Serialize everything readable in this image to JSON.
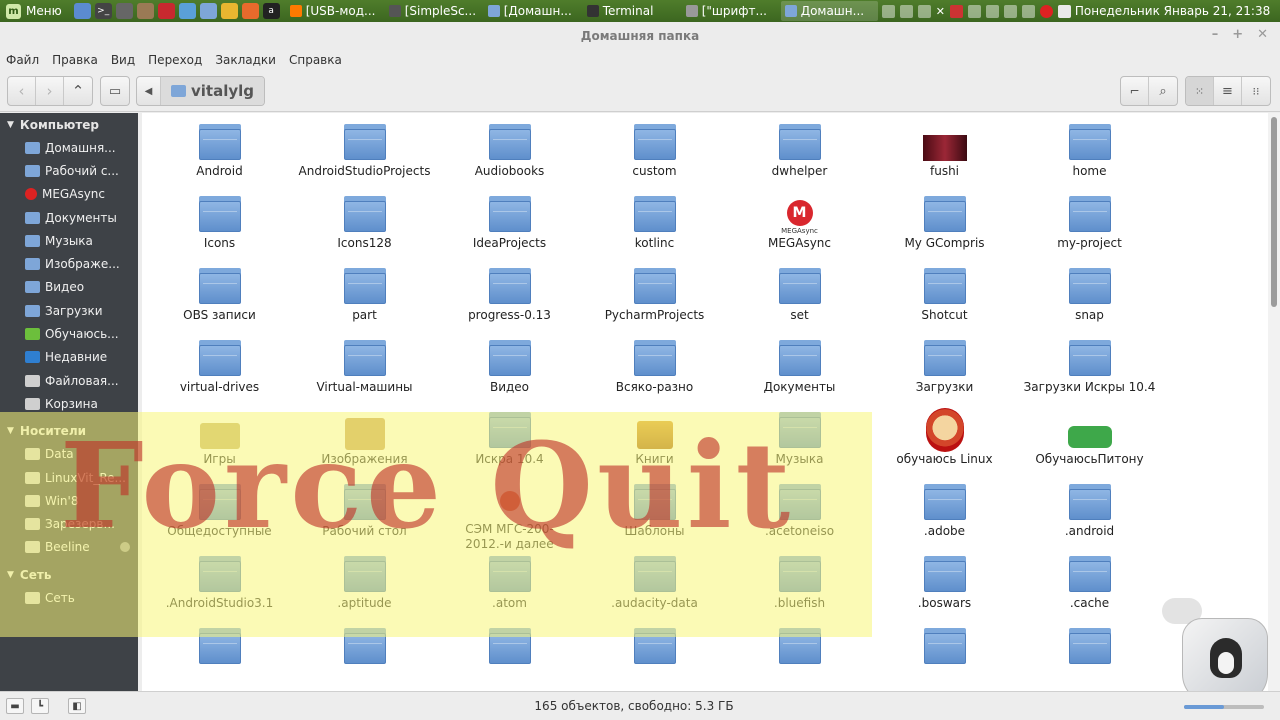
{
  "panel": {
    "menu_label": "Меню",
    "tasks": [
      {
        "label": "[USB-мод...",
        "color": "#ff7a00"
      },
      {
        "label": "[SimpleSc...",
        "color": "#555555"
      },
      {
        "label": "[Домашн...",
        "color": "#7ea6d8"
      },
      {
        "label": "Terminal",
        "color": "#333333"
      },
      {
        "label": "[\"шрифт...",
        "color": "#999999"
      },
      {
        "label": "Домашн...",
        "color": "#7ea6d8"
      }
    ],
    "clock": "Понедельник Январь 21, 21:38"
  },
  "window": {
    "title": "Домашняя папка",
    "menu": [
      "Файл",
      "Правка",
      "Вид",
      "Переход",
      "Закладки",
      "Справка"
    ],
    "path_label": "vitalylg"
  },
  "sidebar": {
    "sections": [
      {
        "title": "Компьютер",
        "items": [
          {
            "label": "Домашня...",
            "icon": "folder-home-icon",
            "style": ""
          },
          {
            "label": "Рабочий с...",
            "icon": "folder-desktop-icon",
            "style": ""
          },
          {
            "label": "MEGAsync",
            "icon": "megasync-icon",
            "style": "red"
          },
          {
            "label": "Документы",
            "icon": "folder-documents-icon",
            "style": ""
          },
          {
            "label": "Музыка",
            "icon": "folder-music-icon",
            "style": ""
          },
          {
            "label": "Изображе...",
            "icon": "folder-pictures-icon",
            "style": ""
          },
          {
            "label": "Видео",
            "icon": "folder-videos-icon",
            "style": ""
          },
          {
            "label": "Загрузки",
            "icon": "folder-downloads-icon",
            "style": ""
          },
          {
            "label": "Обучаюсь...",
            "icon": "bookmark-icon",
            "style": "green"
          },
          {
            "label": "Недавние",
            "icon": "recent-icon",
            "style": "blue"
          },
          {
            "label": "Файловая...",
            "icon": "drive-icon",
            "style": "grey"
          },
          {
            "label": "Корзина",
            "icon": "trash-icon",
            "style": "grey"
          }
        ]
      },
      {
        "title": "Носители",
        "items": [
          {
            "label": "Data",
            "icon": "drive-icon",
            "style": "grey"
          },
          {
            "label": "LinuxVit_Re...",
            "icon": "drive-icon",
            "style": "grey"
          },
          {
            "label": "Win'8",
            "icon": "drive-icon",
            "style": "grey"
          },
          {
            "label": "Зарезерв...",
            "icon": "drive-icon",
            "style": "grey"
          },
          {
            "label": "Beeline",
            "icon": "removable-drive-icon",
            "style": "grey"
          }
        ]
      },
      {
        "title": "Сеть",
        "items": [
          {
            "label": "Сеть",
            "icon": "network-icon",
            "style": "grey"
          }
        ]
      }
    ]
  },
  "files": [
    {
      "label": "Android",
      "icon": "folder"
    },
    {
      "label": "AndroidStudioProjects",
      "icon": "folder"
    },
    {
      "label": "Audiobooks",
      "icon": "folder"
    },
    {
      "label": "custom",
      "icon": "folder"
    },
    {
      "label": "dwhelper",
      "icon": "folder"
    },
    {
      "label": "fushi",
      "icon": "thumb"
    },
    {
      "label": "home",
      "icon": "folder"
    },
    {
      "label": "Icons",
      "icon": "folder"
    },
    {
      "label": "Icons128",
      "icon": "folder"
    },
    {
      "label": "IdeaProjects",
      "icon": "folder"
    },
    {
      "label": "kotlinc",
      "icon": "folder"
    },
    {
      "label": "MEGAsync",
      "icon": "mega"
    },
    {
      "label": "My GCompris",
      "icon": "folder"
    },
    {
      "label": "my-project",
      "icon": "folder"
    },
    {
      "label": "OBS записи",
      "icon": "folder"
    },
    {
      "label": "part",
      "icon": "folder"
    },
    {
      "label": "progress-0.13",
      "icon": "folder"
    },
    {
      "label": "PycharmProjects",
      "icon": "folder"
    },
    {
      "label": "set",
      "icon": "folder"
    },
    {
      "label": "Shotcut",
      "icon": "folder"
    },
    {
      "label": "snap",
      "icon": "folder"
    },
    {
      "label": "virtual-drives",
      "icon": "folder"
    },
    {
      "label": "Virtual-машины",
      "icon": "folder"
    },
    {
      "label": "Видео",
      "icon": "folder"
    },
    {
      "label": "Всяко-разно",
      "icon": "folder"
    },
    {
      "label": "Документы",
      "icon": "folder"
    },
    {
      "label": "Загрузки",
      "icon": "folder"
    },
    {
      "label": "Загрузки Искры 10.4",
      "icon": "folder"
    },
    {
      "label": "Игры",
      "icon": "games"
    },
    {
      "label": "Изображения",
      "icon": "images"
    },
    {
      "label": "Искра 10.4",
      "icon": "folder"
    },
    {
      "label": "Книги",
      "icon": "books"
    },
    {
      "label": "Музыка",
      "icon": "folder"
    },
    {
      "label": "обучаюсь Linux",
      "icon": "penguin"
    },
    {
      "label": "ОбучаюсьПитону",
      "icon": "snake"
    },
    {
      "label": "Общедоступные",
      "icon": "folder"
    },
    {
      "label": "Рабочий стол",
      "icon": "folder"
    },
    {
      "label": "СЭМ МГС-200-2012.-и далее",
      "icon": "warn"
    },
    {
      "label": "Шаблоны",
      "icon": "folder"
    },
    {
      "label": ".acetoneiso",
      "icon": "folder"
    },
    {
      "label": ".adobe",
      "icon": "folder"
    },
    {
      "label": ".android",
      "icon": "folder"
    },
    {
      "label": ".AndroidStudio3.1",
      "icon": "folder"
    },
    {
      "label": ".aptitude",
      "icon": "folder"
    },
    {
      "label": ".atom",
      "icon": "folder"
    },
    {
      "label": ".audacity-data",
      "icon": "folder"
    },
    {
      "label": ".bluefish",
      "icon": "folder"
    },
    {
      "label": ".boswars",
      "icon": "folder"
    },
    {
      "label": ".cache",
      "icon": "folder"
    },
    {
      "label": "",
      "icon": "folder"
    },
    {
      "label": "",
      "icon": "folder"
    },
    {
      "label": "",
      "icon": "folder"
    },
    {
      "label": "",
      "icon": "folder"
    },
    {
      "label": "",
      "icon": "folder"
    },
    {
      "label": "",
      "icon": "folder"
    },
    {
      "label": "",
      "icon": "folder"
    }
  ],
  "overlay": {
    "text": "Force Quit"
  },
  "status": {
    "text": "165 объектов, свободно: 5.3 ГБ",
    "zoom_level": 0.5
  },
  "colors": {
    "panel": "#3c6620",
    "sidebar": "#3e4247",
    "folder": "#7ea9dc"
  }
}
